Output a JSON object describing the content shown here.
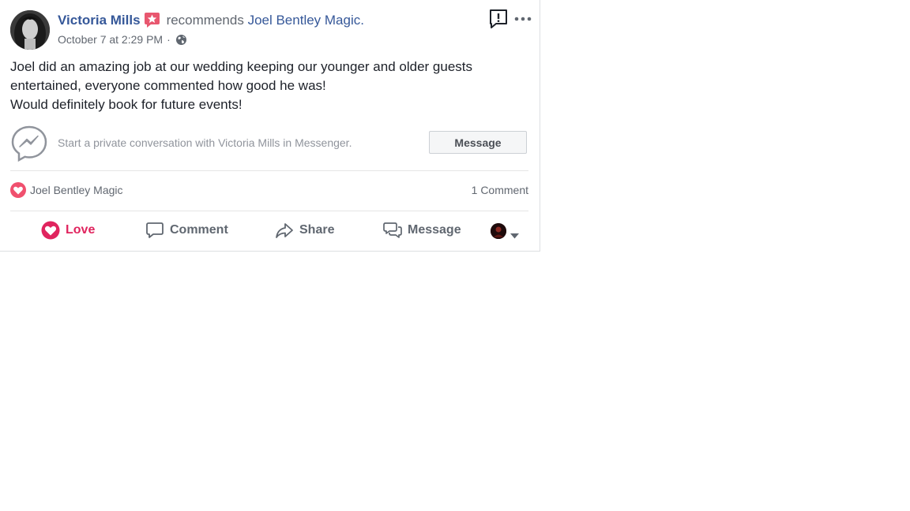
{
  "post": {
    "author": "Victoria Mills",
    "recommends_text": "recommends",
    "page_name": "Joel Bentley Magic.",
    "timestamp": "October 7 at 2:29 PM",
    "separator": "·",
    "privacy_icon": "globe-icon",
    "body_lines": [
      "Joel did an amazing job at our wedding keeping our younger and older guests",
      "entertained, everyone commented how good he was!",
      "Would definitely book for future events!"
    ]
  },
  "messenger": {
    "prompt": "Start a private conversation with Victoria Mills in Messenger.",
    "button_label": "Message"
  },
  "reactions": {
    "reactor": "Joel Bentley Magic",
    "comment_count": "1 Comment"
  },
  "actions": {
    "love": "Love",
    "comment": "Comment",
    "share": "Share",
    "message": "Message"
  },
  "colors": {
    "link": "#365899",
    "love": "#e0245e",
    "muted": "#616770",
    "divider": "#e5e5e5"
  }
}
